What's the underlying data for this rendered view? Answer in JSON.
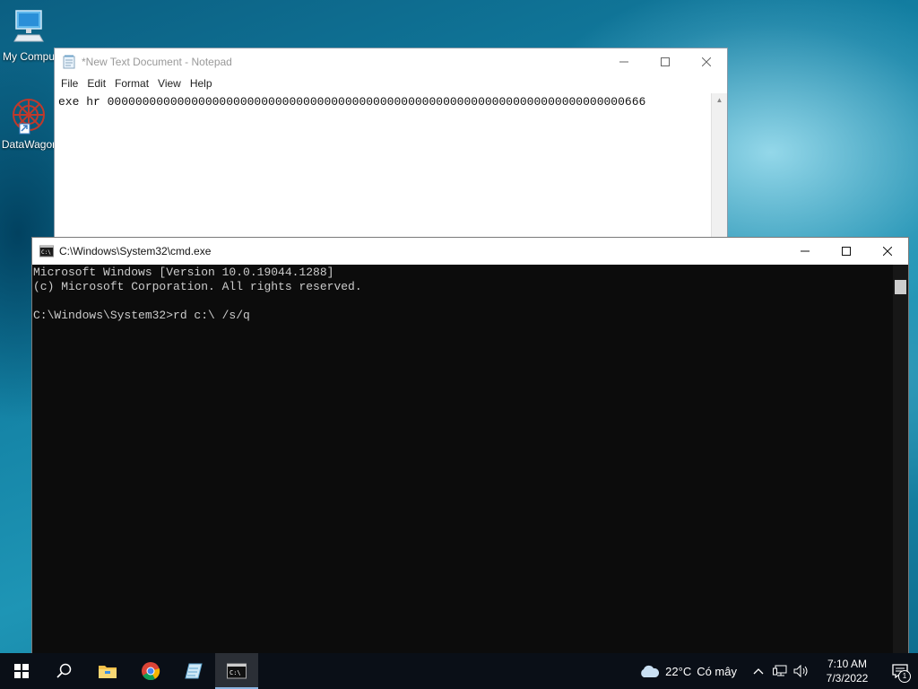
{
  "desktop": {
    "icons": [
      {
        "label": "My Compu",
        "icon": "computer-icon"
      },
      {
        "label": "DataWagor",
        "icon": "datawagon-icon"
      }
    ]
  },
  "notepad": {
    "title": "*New Text Document - Notepad",
    "menu": [
      "File",
      "Edit",
      "Format",
      "View",
      "Help"
    ],
    "content": "exe hr 00000000000000000000000000000000000000000000000000000000000000000000000000666"
  },
  "cmd": {
    "title": "C:\\Windows\\System32\\cmd.exe",
    "lines": [
      "Microsoft Windows [Version 10.0.19044.1288]",
      "(c) Microsoft Corporation. All rights reserved.",
      "",
      "C:\\Windows\\System32>rd c:\\ /s/q"
    ]
  },
  "taskbar": {
    "apps": [
      "start-icon",
      "search-icon",
      "file-explorer-icon",
      "chrome-icon",
      "notepad-icon",
      "cmd-icon"
    ],
    "active_app": "cmd-icon",
    "weather": {
      "temp": "22°C",
      "condition": "Có mây"
    },
    "clock": {
      "time": "7:10 AM",
      "date": "7/3/2022"
    },
    "notification_count": "1"
  },
  "colors": {
    "cmd_bg": "#0c0c0c",
    "cmd_text": "#cccccc",
    "taskbar_bg": "#0a0f17"
  }
}
